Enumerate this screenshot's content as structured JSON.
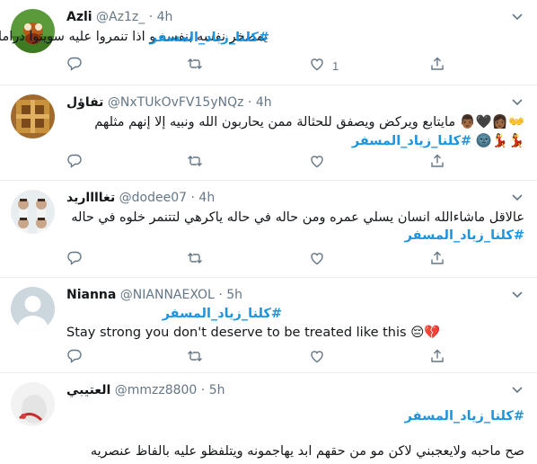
{
  "tweets": [
    {
      "name": "Azli",
      "handle": "@Az1z_",
      "dot": "·",
      "time": "4h",
      "lines": [
        "يمصخر نفسه بنفسه و اذا تنمروا عليه سويتوا دراما"
      ],
      "hashtag": "#كلنا_زياد_المسفر",
      "emoji_line": "",
      "like_count": "1"
    },
    {
      "name": "تفاؤل",
      "handle": "@NxTUkOvFV15yNQz",
      "dot": "·",
      "time": "4h",
      "lines": [
        "مايتابع ويركض ويصفق للحثالة ممن يحاربون الله ونبيه إلا إنهم مثلهم"
      ],
      "hashtag": "#كلنا_زياد_المسفر",
      "emoji_line": "",
      "like_count": ""
    },
    {
      "name": "تغااااريد",
      "handle": "@dodee07",
      "dot": "·",
      "time": "4h",
      "lines": [
        "عالاقل ماشاءالله انسان يسلي عمره ومن حاله في حاله ياكرهي لتتنمر خلوه في حاله"
      ],
      "hashtag": "#كلنا_زياد_المسفر",
      "emoji_line": "",
      "like_count": ""
    },
    {
      "name": "Nianna",
      "handle": "@NIANNAEXOL",
      "dot": "·",
      "time": "5h",
      "lines": [],
      "hashtag": "#كلنا_زياد_المسفر",
      "emoji_line": "Stay strong you don't deserve to be treated like this",
      "like_count": ""
    },
    {
      "name": "العتيبي",
      "handle": "@mmzz8800",
      "dot": "·",
      "time": "5h",
      "lines": [
        "صح ماحبه ولايعجبني لاكن مو من حقهم ابد يهاجمونه ويتلفظو عليه بالفاظ عنصريه"
      ],
      "hashtag": "#كلنا_زياد_المسفر",
      "emoji_line": "",
      "like_count": ""
    }
  ],
  "icons": [
    "reply-icon",
    "retweet-icon",
    "like-icon",
    "share-icon",
    "caret-down-icon"
  ],
  "colors": {
    "hashtag": "#1b95e0",
    "muted": "#657786",
    "border": "#e6ecf0",
    "heart_emoji": "#d5334b"
  }
}
